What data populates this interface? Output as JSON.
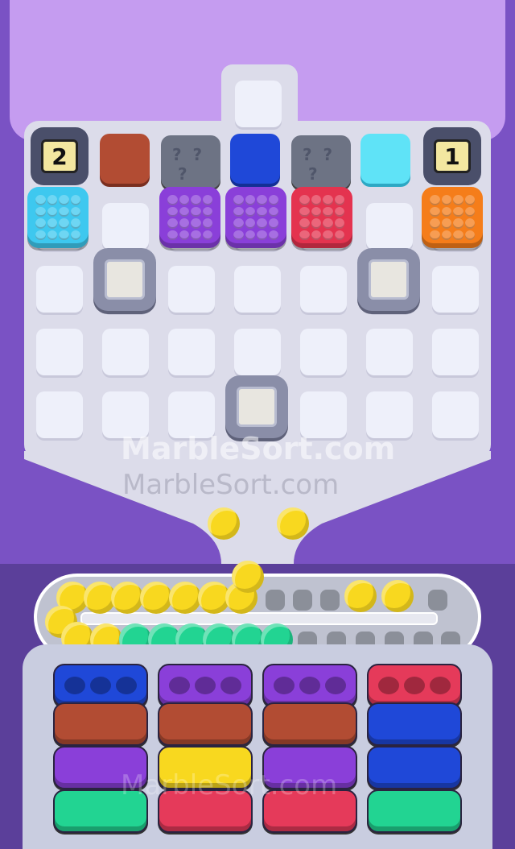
{
  "tags": {
    "left_number": "2",
    "right_number": "1"
  },
  "watermark": {
    "primary": "MarbleSort.com",
    "secondary": "MarbleSort.com",
    "bottom": "MarbleSort.com"
  },
  "colors": {
    "cyan": "#3ec8ef",
    "purple": "#8a3fd9",
    "red": "#e4334f",
    "orange": "#f57d1a",
    "brick": "#b24c33",
    "blue": "#1f48d8",
    "light_cyan": "#5fe3f7",
    "yellow": "#f8d81f",
    "green": "#22d492",
    "pink": "#e53a5a"
  },
  "top_row": [
    {
      "type": "number-tag",
      "value_key": "left_number"
    },
    {
      "type": "tile",
      "color": "brick"
    },
    {
      "type": "stone"
    },
    {
      "type": "tile",
      "color": "blue"
    },
    {
      "type": "stone"
    },
    {
      "type": "tile",
      "color": "light_cyan"
    },
    {
      "type": "number-tag",
      "value_key": "right_number"
    }
  ],
  "crates": [
    "cyan",
    "purple",
    "purple",
    "red",
    "orange"
  ],
  "marbles": {
    "yellow_count": 13,
    "green_count": 6,
    "empty_slots": 14
  },
  "bins": {
    "columns": 4,
    "rows": [
      [
        "blue",
        "purple",
        "purple",
        "pink"
      ],
      [
        "brick",
        "brick",
        "brick",
        "blue"
      ],
      [
        "purple",
        "yellow",
        "purple",
        "blue"
      ],
      [
        "green",
        "pink",
        "pink",
        "green"
      ]
    ]
  }
}
